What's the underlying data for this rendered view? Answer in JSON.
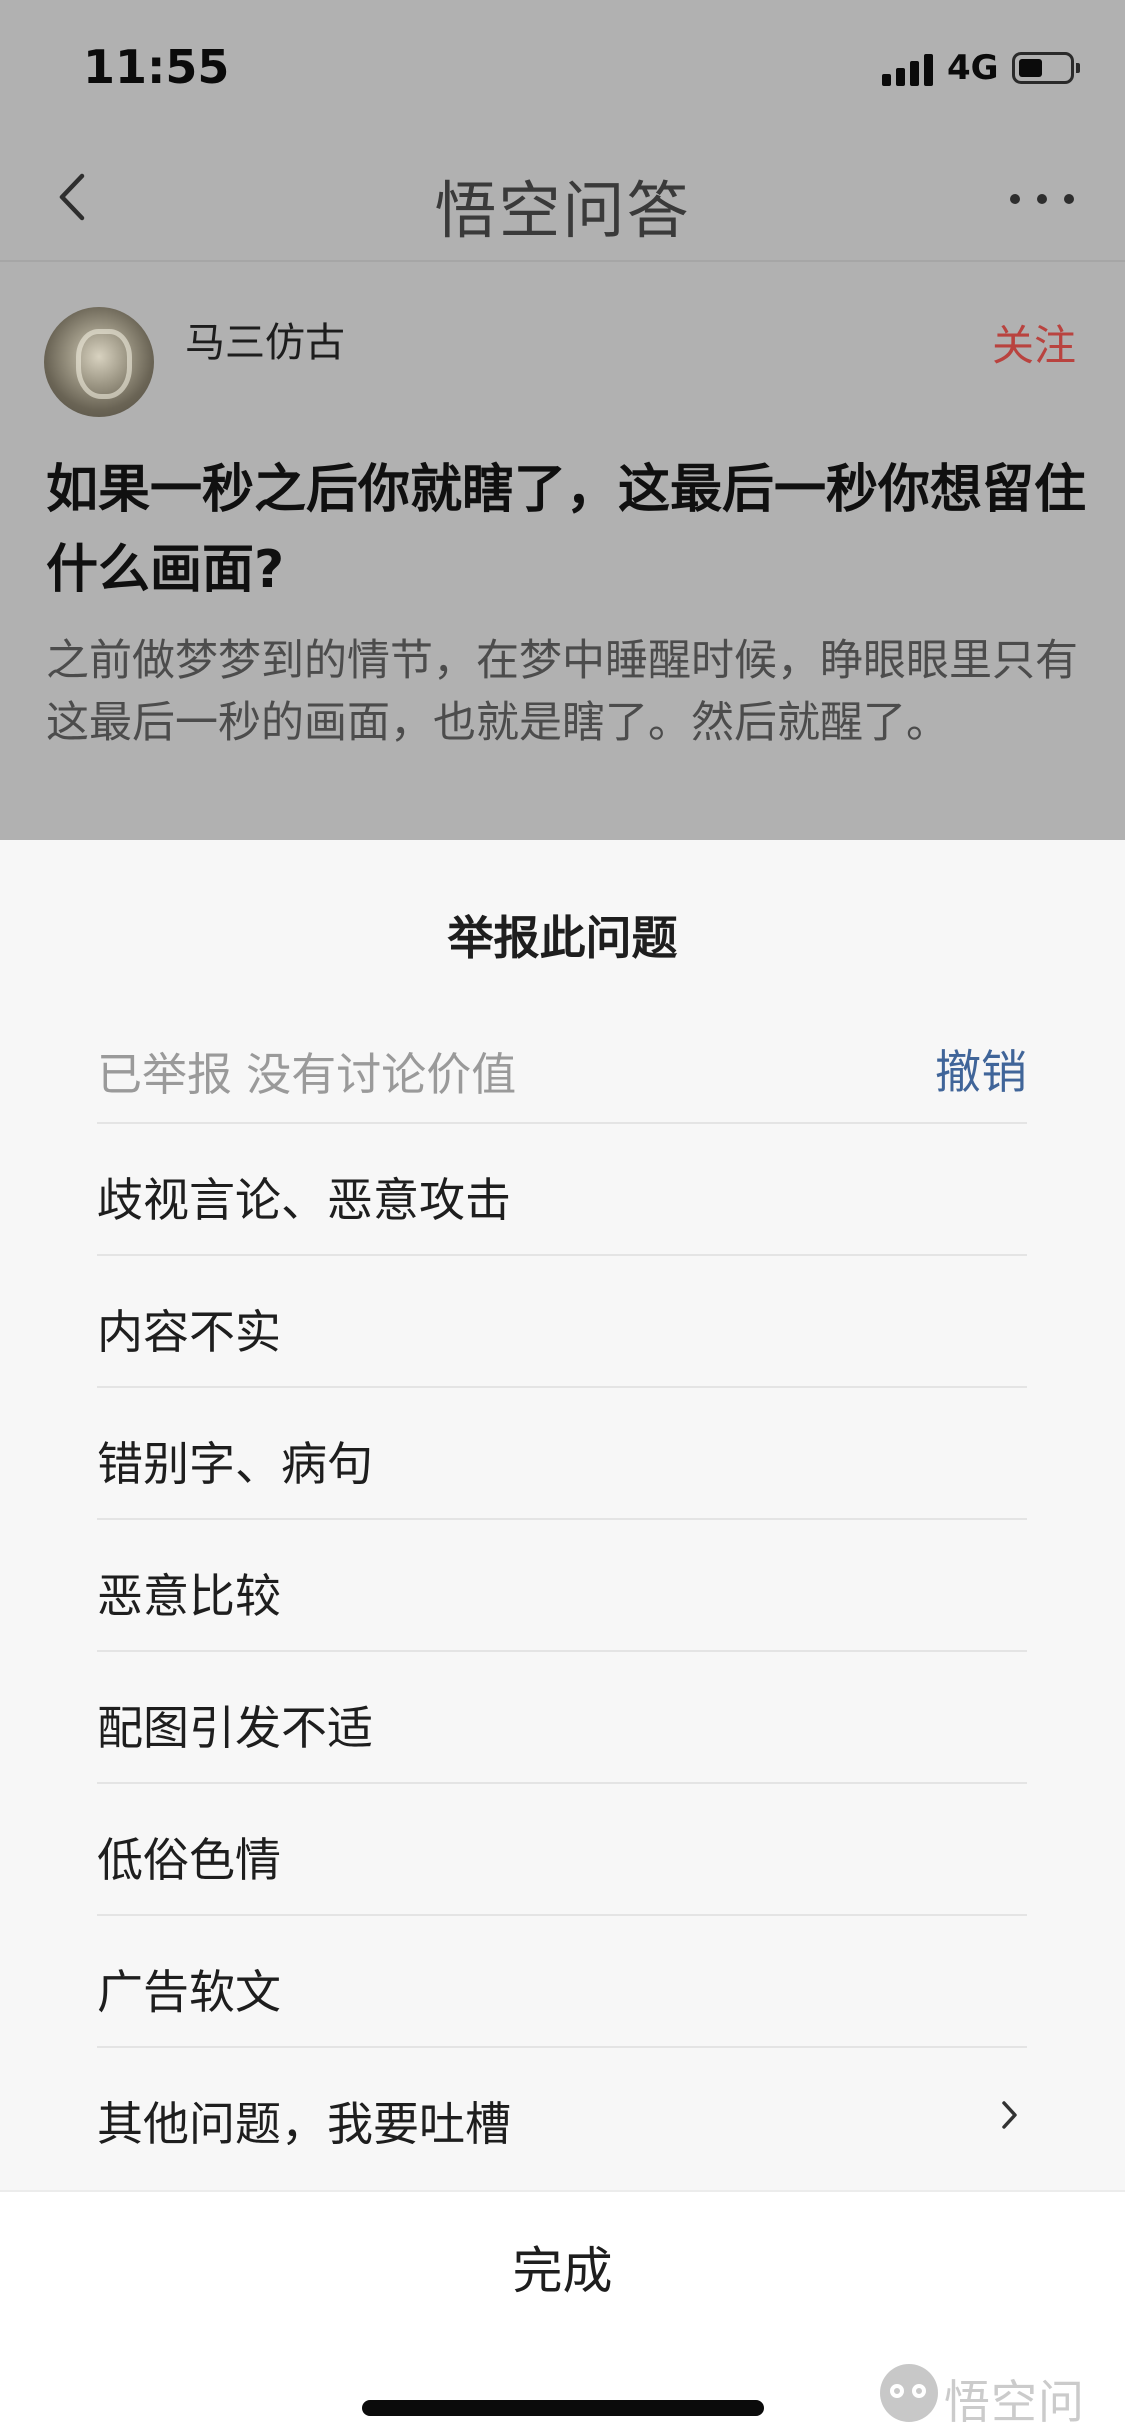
{
  "status_bar": {
    "time": "11:55",
    "network": "4G",
    "signal_bars": 4,
    "battery_level_percent": 45
  },
  "nav": {
    "title": "悟空问答",
    "back_icon": "chevron-left-icon",
    "more_icon": "more-dots-icon"
  },
  "author": {
    "name": "马三仿古",
    "follow_label": "关注"
  },
  "question": {
    "title": "如果一秒之后你就瞎了，这最后一秒你想留住什么画面?",
    "description": "之前做梦梦到的情节，在梦中睡醒时候，睁眼眼里只有这最后一秒的画面，也就是瞎了。然后就醒了。"
  },
  "report": {
    "title": "举报此问题",
    "reported_label": "已举报 没有讨论价值",
    "undo_label": "撤销",
    "reasons": [
      {
        "label": "歧视言论、恶意攻击"
      },
      {
        "label": "内容不实"
      },
      {
        "label": "错别字、病句"
      },
      {
        "label": "恶意比较"
      },
      {
        "label": "配图引发不适"
      },
      {
        "label": "低俗色情"
      },
      {
        "label": "广告软文"
      },
      {
        "label": "其他问题，我要吐槽"
      }
    ],
    "done_label": "完成"
  },
  "watermark": {
    "text": "悟空问答"
  },
  "colors": {
    "follow": "#b9433f",
    "undo": "#406599",
    "dim_background": "#b1b1b1",
    "sheet_background": "#f7f7f7"
  }
}
